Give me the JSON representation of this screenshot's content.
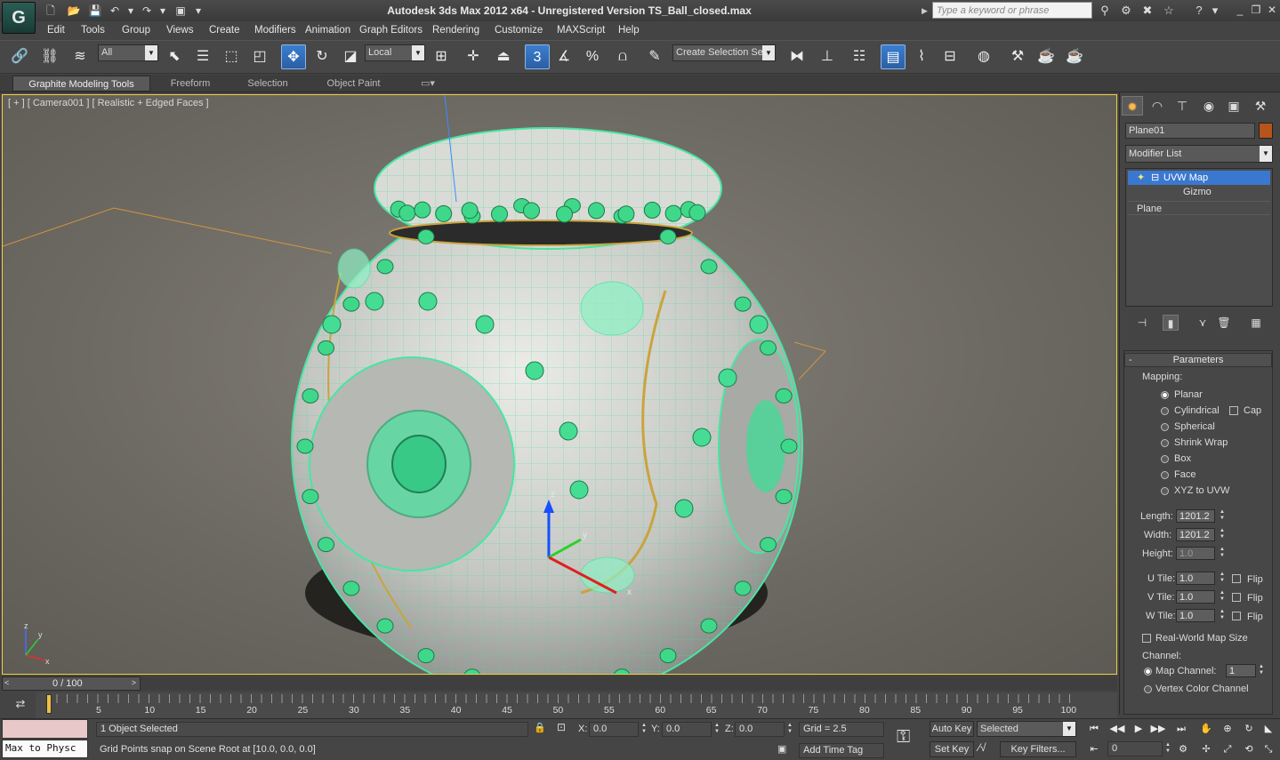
{
  "window": {
    "title": "Autodesk 3ds Max  2012 x64  -  Unregistered Version   TS_Ball_closed.max",
    "search_placeholder": "Type a keyword or phrase",
    "logo": "G",
    "minimize": "_",
    "restore": "❐",
    "close": "✕"
  },
  "menu": [
    "Edit",
    "Tools",
    "Group",
    "Views",
    "Create",
    "Modifiers",
    "Animation",
    "Graph Editors",
    "Rendering",
    "Customize",
    "MAXScript",
    "Help"
  ],
  "toolbar": {
    "selection_filter": "All",
    "reference_coord": "Local",
    "named_selection": "Create Selection Se",
    "snap_label": "3",
    "percent_snap": "%"
  },
  "ribbon_tabs": [
    "Graphite Modeling Tools",
    "Freeform",
    "Selection",
    "Object Paint"
  ],
  "viewport": {
    "label": "[ + ] [ Camera001 ] [ Realistic + Edged Faces ]",
    "gizmo_axes": [
      "z",
      "y",
      "x"
    ],
    "corner_axes": [
      "z",
      "y",
      "x"
    ]
  },
  "command_panel": {
    "object_name": "Plane01",
    "object_color": "#b5541b",
    "modifier_list": "Modifier List",
    "stack": [
      {
        "label": "UVW Map",
        "selected": true
      },
      {
        "label": "Gizmo",
        "selected": false
      },
      {
        "label": "Plane",
        "selected": false
      }
    ],
    "rollout_title": "Parameters",
    "mapping_label": "Mapping:",
    "mapping_options": [
      "Planar",
      "Cylindrical",
      "Spherical",
      "Shrink Wrap",
      "Box",
      "Face",
      "XYZ to UVW"
    ],
    "mapping_selected": "Planar",
    "cap_label": "Cap",
    "length_label": "Length:",
    "length_value": "1201.2",
    "width_label": "Width:",
    "width_value": "1201.2",
    "height_label": "Height:",
    "height_value": "1.0",
    "utile_label": "U Tile:",
    "utile_value": "1.0",
    "vtile_label": "V Tile:",
    "vtile_value": "1.0",
    "wtile_label": "W Tile:",
    "wtile_value": "1.0",
    "flip_label": "Flip",
    "realworld_label": "Real-World Map Size",
    "channel_label": "Channel:",
    "map_channel_label": "Map Channel:",
    "map_channel_value": "1",
    "vertex_color_label": "Vertex Color Channel"
  },
  "timeline": {
    "frame_display": "0 / 100",
    "ticks": [
      "5",
      "10",
      "15",
      "20",
      "25",
      "30",
      "35",
      "40",
      "45",
      "50",
      "55",
      "60",
      "65",
      "70",
      "75",
      "80",
      "85",
      "90",
      "95",
      "100"
    ]
  },
  "status": {
    "maxscript_output": "Max to Physc",
    "selection_count": "1 Object Selected",
    "prompt": "Grid Points snap on Scene Root at [10.0, 0.0, 0.0]",
    "x_label": "X:",
    "x_value": "0.0",
    "y_label": "Y:",
    "y_value": "0.0",
    "z_label": "Z:",
    "z_value": "0.0",
    "grid": "Grid = 2.5",
    "add_time_tag": "Add Time Tag",
    "auto_key": "Auto Key",
    "set_key": "Set Key",
    "key_mode": "Selected",
    "key_filters": "Key Filters...",
    "current_frame": "0"
  }
}
